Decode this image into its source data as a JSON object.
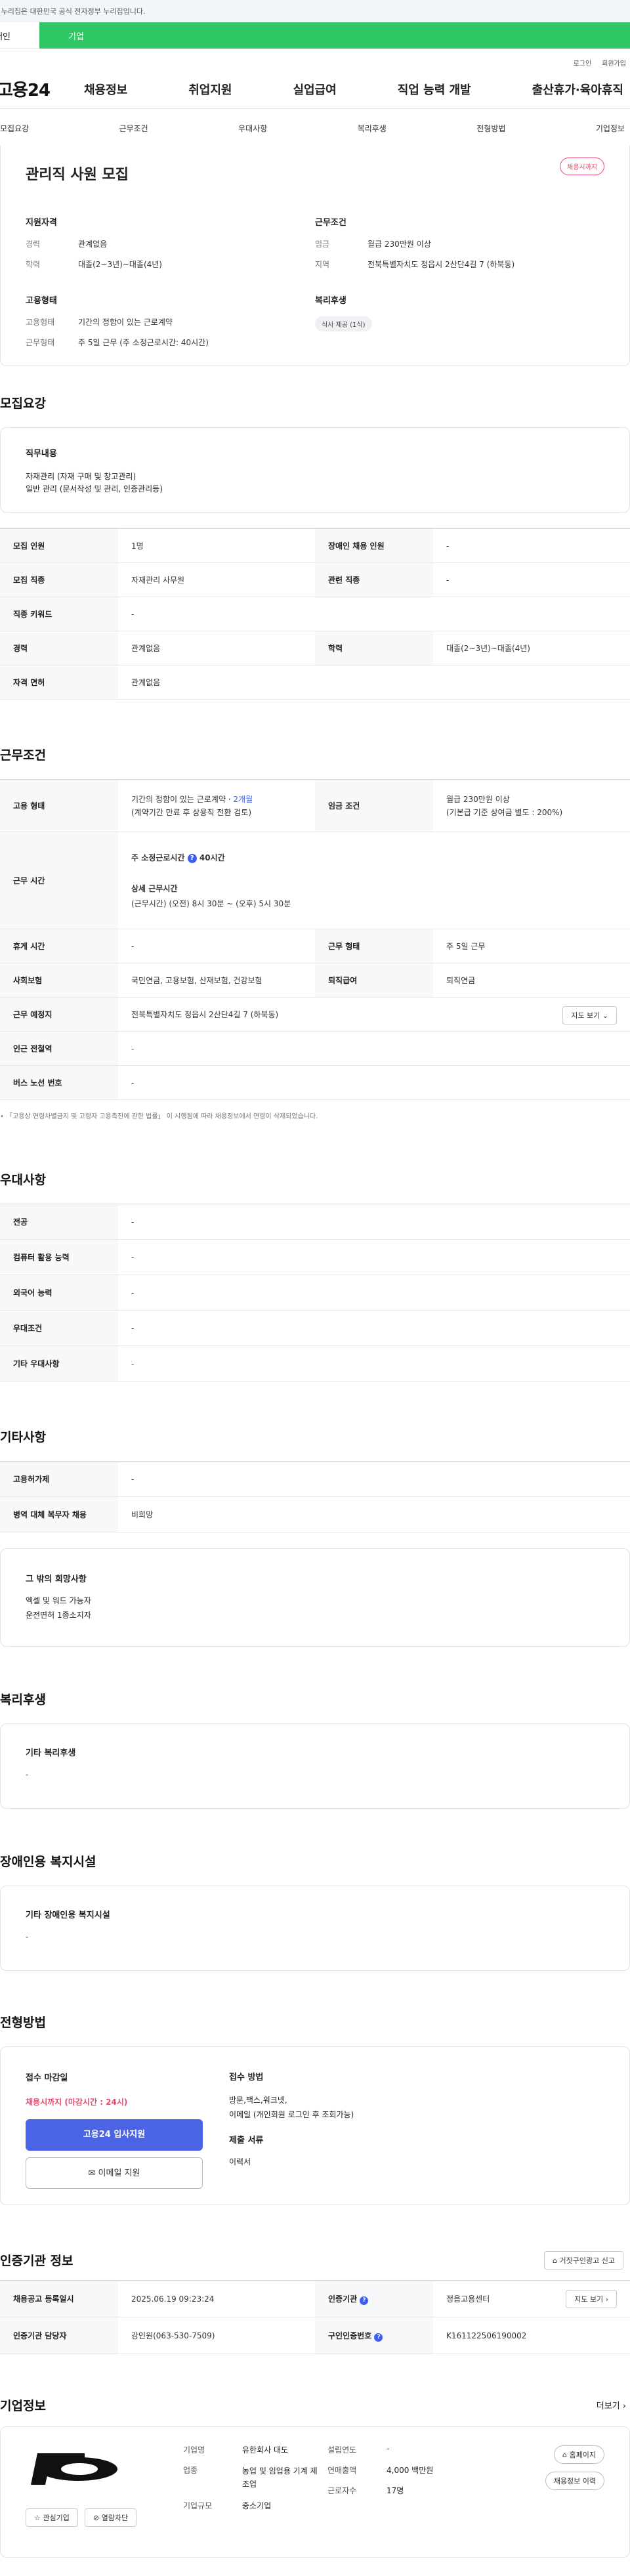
{
  "gov_bar": {
    "text": "이 누리집은 대한민국 공식 전자정부 누리집입니다."
  },
  "top_tabs": [
    "개인",
    "기업"
  ],
  "util": {
    "login": "로그인",
    "join": "회원가입"
  },
  "gnb": {
    "logo": "고용24",
    "menu": [
      "채용정보",
      "취업지원",
      "실업급여",
      "직업 능력 개발",
      "출산휴가·육아휴직"
    ]
  },
  "anchor_nav": [
    "모집요강",
    "근무조건",
    "우대사항",
    "복리후생",
    "전형방법",
    "기업정보"
  ],
  "summary": {
    "title": "관리직 사원 모집",
    "badge": "채용시까지",
    "qual": {
      "heading": "지원자격",
      "rows": [
        {
          "k": "경력",
          "v": "관계없음"
        },
        {
          "k": "학력",
          "v": "대졸(2~3년)~대졸(4년)"
        }
      ]
    },
    "cond": {
      "heading": "근무조건",
      "rows": [
        {
          "k": "임금",
          "v": "월급 230만원 이상"
        },
        {
          "k": "지역",
          "v": "전북특별자치도 정읍시 2산단4길 7 (하북동)"
        }
      ]
    },
    "emp": {
      "heading": "고용형태",
      "rows": [
        {
          "k": "고용형태",
          "v": "기간의 정함이 있는 근로계약"
        },
        {
          "k": "근무형태",
          "v": "주 5일 근무 (주 소정근로시간: 40시간)"
        }
      ]
    },
    "welfare": {
      "heading": "복리후생",
      "chip": "식사 제공 (1식)"
    }
  },
  "recruit": {
    "title": "모집요강",
    "duty_heading": "직무내용",
    "duty_lines": [
      "자재관리 (자재 구매 및 창고관리)",
      "일반 관리 (문서작성 및 관리, 인증관리등)"
    ],
    "rows": [
      [
        {
          "k": "모집 인원",
          "v": "1명"
        },
        {
          "k": "장애인 채용 인원",
          "v": "-"
        }
      ],
      [
        {
          "k": "모집 직종",
          "v": "자재관리 사무원"
        },
        {
          "k": "관련 직종",
          "v": "-"
        }
      ],
      [
        {
          "k": "직종 키워드",
          "v": "-"
        }
      ],
      [
        {
          "k": "경력",
          "v": "관계없음"
        },
        {
          "k": "학력",
          "v": "대졸(2~3년)~대졸(4년)"
        }
      ],
      [
        {
          "k": "자격 면허",
          "v": "관계없음"
        }
      ]
    ]
  },
  "work": {
    "title": "근무조건",
    "emp_type_k": "고용 형태",
    "emp_type_v1": "기간의 정함이 있는 근로계약 ·",
    "emp_type_v1_accent": "2개월",
    "emp_type_v2": "(계약기간 만료 후 상용직 전환 검토)",
    "wage_k": "임금 조건",
    "wage_v1": "월급 230만원 이상",
    "wage_v2": "(기본급 기준 상여금 별도 : 200%)",
    "hours_k": "근무 시간",
    "hours_main": "주 소정근로시간",
    "hours_main_value": "40시간",
    "hours_detail_h": "상세 근무시간",
    "hours_detail": "(근무시간) (오전) 8시 30분 ~ (오후) 5시 30분",
    "rest_k": "휴게 시간",
    "rest_v": "-",
    "form_k": "근무 형태",
    "form_v": "주 5일 근무",
    "ins_k": "사회보험",
    "ins_v": "국민연금, 고용보험, 산재보험, 건강보험",
    "sev_k": "퇴직급여",
    "sev_v": "퇴직연금",
    "place_k": "근무 예정지",
    "place_v": "전북특별자치도 정읍시 2산단4길 7 (하북동)",
    "map_btn": "지도 보기",
    "subway_k": "인근 전철역",
    "subway_v": "-",
    "bus_k": "버스 노선 번호",
    "bus_v": "-",
    "note": "「고용상 연령차별금지 및 고령자 고용촉진에 관한 법률」 이 시행됨에 따라 채용정보에서 연령이 삭제되었습니다."
  },
  "pref": {
    "title": "우대사항",
    "rows": [
      {
        "k": "전공",
        "v": "-"
      },
      {
        "k": "컴퓨터 활용 능력",
        "v": "-"
      },
      {
        "k": "외국어 능력",
        "v": "-"
      },
      {
        "k": "우대조건",
        "v": "-"
      },
      {
        "k": "기타 우대사항",
        "v": "-"
      }
    ]
  },
  "etc": {
    "title": "기타사항",
    "rows": [
      {
        "k": "고용허가제",
        "v": "-"
      },
      {
        "k": "병역 대체 복무자 채용",
        "v": "비희망"
      }
    ],
    "wish_h": "그 밖의 희망사항",
    "wish_lines": [
      "엑셀 및 워드 가능자",
      "운전면허 1종소지자"
    ]
  },
  "welfare": {
    "title": "복리후생",
    "h": "기타 복리후생",
    "v": "-"
  },
  "disability": {
    "title": "장애인용 복지시설",
    "h": "기타 장애인용 복지시설",
    "v": "-"
  },
  "apply": {
    "title": "전형방법",
    "deadline_h": "접수 마감일",
    "deadline_v": "채용시까지 (마감시간 : 24시)",
    "apply_btn": "고용24 입사지원",
    "email_btn": "이메일 지원",
    "method_h": "접수 방법",
    "method_lines": [
      "방문,팩스,워크넷,",
      "이메일 (개인회원 로그인 후 조회가능)"
    ],
    "docs_h": "제출 서류",
    "docs_v": "이력서"
  },
  "cert": {
    "title": "인증기관 정보",
    "report_btn": "거짓구인광고 신고",
    "rows": [
      {
        "k1": "채용공고 등록일시",
        "v1": "2025.06.19 09:23:24",
        "k2": "인증기관",
        "v2": "정읍고용센터",
        "btn": "지도 보기"
      },
      {
        "k1": "인증기관 담당자",
        "v1": "강인원(063-530-7509)",
        "k2": "구인인증번호",
        "v2": "K161122506190002"
      }
    ]
  },
  "company": {
    "title": "기업정보",
    "more": "더보기",
    "fav_btn": "관심기업",
    "block_btn": "열람차단",
    "col1": [
      {
        "k": "기업명",
        "v": "유한회사 대도"
      },
      {
        "k": "업종",
        "v": "농업 및 임업용 기계 제조업"
      },
      {
        "k": "기업규모",
        "v": "중소기업"
      }
    ],
    "col2": [
      {
        "k": "설립연도",
        "v": "-"
      },
      {
        "k": "연매출액",
        "v": "4,000 백만원"
      },
      {
        "k": "근로자수",
        "v": "17명"
      }
    ],
    "home_btn": "홈페이지",
    "history_btn": "채용정보 이력"
  },
  "colors": {
    "green": "#2fc765",
    "blue": "#4b64e6",
    "pink": "#e14d70",
    "accent_blue": "#3d5ff5"
  }
}
